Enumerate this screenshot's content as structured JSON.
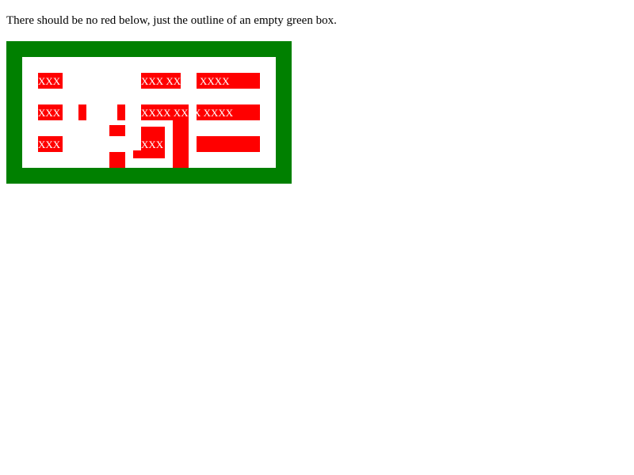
{
  "instruction_text": "There should be no red below, just the outline of an empty green box.",
  "labels": {
    "r1c1": "XXX",
    "r1c2": "XXX XX",
    "r1c3": "XXXX",
    "r2c1": "XXX",
    "r2c2": "XXXX XXX",
    "r2c3": "X XXXX",
    "r3c1": "XXX",
    "r3c2": "XXX"
  },
  "colors": {
    "outline": "#008000",
    "error": "#ff0000",
    "background": "#ffffff"
  }
}
